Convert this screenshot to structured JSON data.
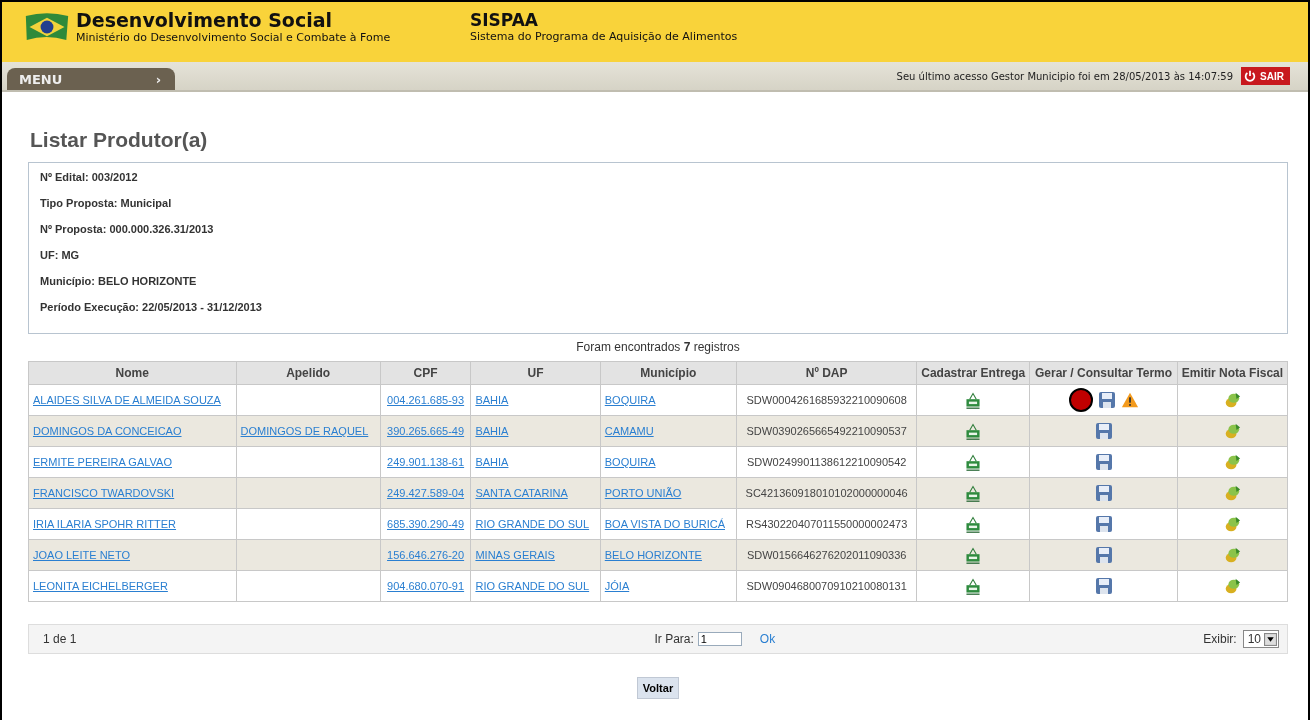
{
  "header": {
    "org_title": "Desenvolvimento Social",
    "org_subtitle": "Ministério do Desenvolvimento Social e Combate à Fome",
    "system_title": "SISPAA",
    "system_subtitle": "Sistema do Programa de Aquisição de Alimentos"
  },
  "menu_bar": {
    "menu_label": "MENU",
    "menu_arrow": "›",
    "last_access": "Seu último acesso Gestor Municipio foi em 28/05/2013 às 14:07:59",
    "logout_label": "SAIR"
  },
  "page_title": "Listar Produtor(a)",
  "info": [
    "Nº Edital: 003/2012",
    "Tipo Proposta: Municipal",
    "Nº Proposta: 000.000.326.31/2013",
    "UF: MG",
    "Município: BELO HORIZONTE",
    "Período Execução: 22/05/2013 - 31/12/2013"
  ],
  "result_count": "Foram encontrados **7** registros",
  "table": {
    "columns": [
      "Nome",
      "Apelido",
      "CPF",
      "UF",
      "Município",
      "Nº DAP",
      "Cadastrar Entrega",
      "Gerar / Consultar Termo",
      "Emitir Nota Fiscal"
    ],
    "rows": [
      {
        "nome": "ALAIDES SILVA DE ALMEIDA SOUZA",
        "cpf": "004.261.685-93",
        "uf": "BAHIA",
        "municipio": "BOQUIRA",
        "dap": "SDW0004261685932210090608",
        "marked": true,
        "warning": true
      },
      {
        "nome": "DOMINGOS DA CONCEICAO",
        "apelido": "DOMINGOS DE RAQUEL",
        "cpf": "390.265.665-49",
        "uf": "BAHIA",
        "municipio": "CAMAMU",
        "dap": "SDW0390265665492210090537",
        "marked": false,
        "warning": false
      },
      {
        "nome": "ERMITE PEREIRA GALVAO",
        "cpf": "249.901.138-61",
        "uf": "BAHIA",
        "municipio": "BOQUIRA",
        "dap": "SDW0249901138612210090542",
        "marked": false,
        "warning": false
      },
      {
        "nome": "FRANCISCO TWARDOVSKI",
        "cpf": "249.427.589-04",
        "uf": "SANTA CATARINA",
        "municipio": "PORTO UNIÃO",
        "dap": "SC421360918010102000000046",
        "marked": false,
        "warning": false
      },
      {
        "nome": "IRIA ILARIA SPOHR RITTER",
        "cpf": "685.390.290-49",
        "uf": "RIO GRANDE DO SUL",
        "municipio": "BOA VISTA DO BURICÁ",
        "dap": "RS430220407011550000002473",
        "marked": false,
        "warning": false
      },
      {
        "nome": "JOAO LEITE NETO",
        "cpf": "156.646.276-20",
        "uf": "MINAS GERAIS",
        "municipio": "BELO HORIZONTE",
        "dap": "SDW0156646276202011090336",
        "marked": false,
        "warning": false
      },
      {
        "nome": "LEONITA EICHELBERGER",
        "cpf": "904.680.070-91",
        "uf": "RIO GRANDE DO SUL",
        "municipio": "JÓIA",
        "dap": "SDW0904680070910210080131",
        "marked": false,
        "warning": false
      }
    ]
  },
  "pagination": {
    "page_info": "1 de 1",
    "goto_label": "Ir Para:",
    "goto_value": "1",
    "ok_label": "Ok",
    "show_label": "Exibir:",
    "show_value": "10"
  },
  "back_button": "Voltar"
}
